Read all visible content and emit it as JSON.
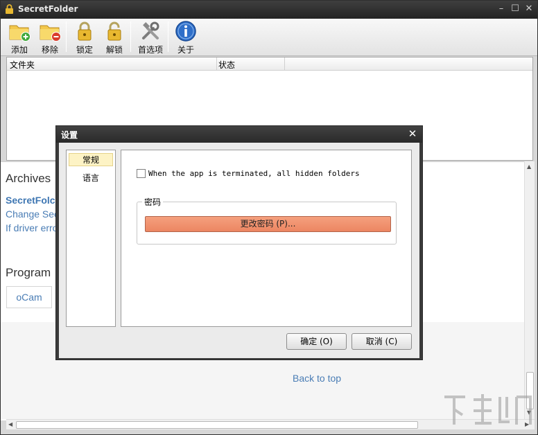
{
  "window": {
    "title": "SecretFolder",
    "controls": {
      "minimize": "–",
      "maximize": "☐",
      "close": "✕"
    }
  },
  "toolbar": {
    "items": [
      {
        "label": "添加",
        "icon": "folder-add-icon"
      },
      {
        "label": "移除",
        "icon": "folder-remove-icon"
      },
      {
        "label": "锁定",
        "icon": "lock-closed-icon"
      },
      {
        "label": "解锁",
        "icon": "lock-open-icon"
      },
      {
        "label": "首选项",
        "icon": "tools-icon"
      },
      {
        "label": "关于",
        "icon": "info-icon"
      }
    ]
  },
  "listview": {
    "columns": [
      "文件夹",
      "状态"
    ]
  },
  "web": {
    "archives_heading": "Archives",
    "archive_links": [
      "SecretFolc",
      "Change Sec",
      "If driver erro"
    ],
    "program_heading": "Program",
    "program_item": "oCam",
    "back_to_top": "Back to top"
  },
  "dialog": {
    "title": "设置",
    "close": "✕",
    "nav": [
      {
        "label": "常规",
        "selected": true
      },
      {
        "label": "语言",
        "selected": false
      }
    ],
    "general": {
      "checkbox_label": "When the app is terminated, all hidden folders",
      "checkbox_checked": false,
      "password_group": "密码",
      "change_password_button": "更改密码 (P)..."
    },
    "ok_button": "确定 (O)",
    "cancel_button": "取消 (C)"
  },
  "colors": {
    "accent_button": "#ec8662",
    "link": "#4a7db5",
    "selected_nav": "#fdf3c5"
  }
}
